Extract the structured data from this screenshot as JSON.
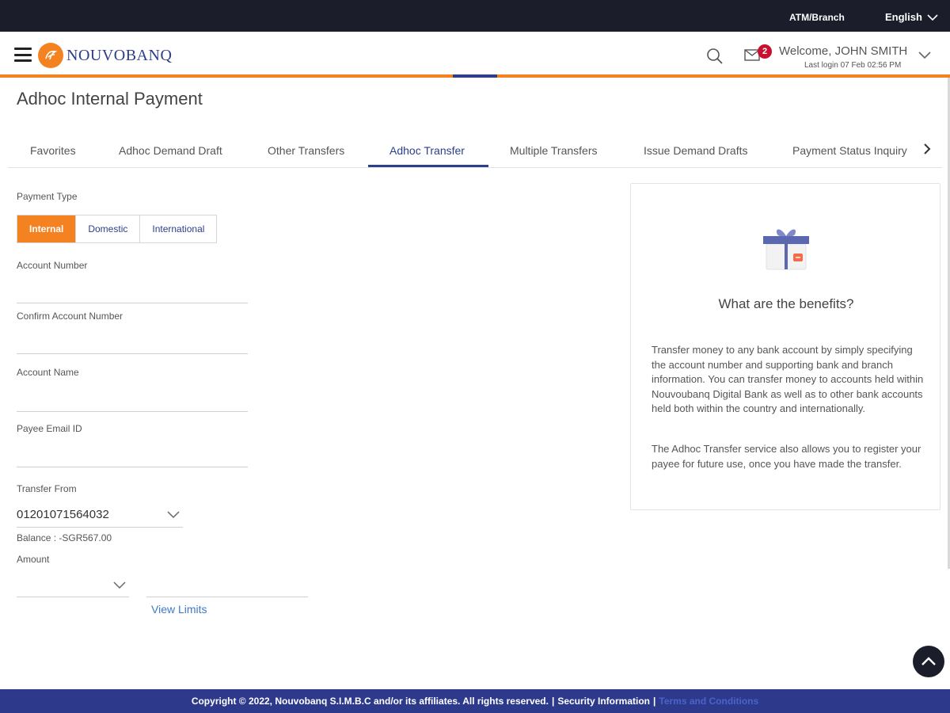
{
  "topbar": {
    "atm_branch": "ATM/Branch",
    "language": "English"
  },
  "header": {
    "logo_text": "NOUVOBANQ",
    "mail_count": "2",
    "welcome": "Welcome, JOHN SMITH",
    "last_login": "Last login 07 Feb 02:56 PM"
  },
  "page": {
    "title": "Adhoc Internal Payment"
  },
  "tabs": [
    {
      "label": "Favorites"
    },
    {
      "label": "Adhoc Demand Draft"
    },
    {
      "label": "Other Transfers"
    },
    {
      "label": "Adhoc Transfer",
      "active": true
    },
    {
      "label": "Multiple Transfers"
    },
    {
      "label": "Issue Demand Drafts"
    },
    {
      "label": "Payment Status Inquiry"
    }
  ],
  "form": {
    "payment_type_label": "Payment Type",
    "payment_types": [
      "Internal",
      "Domestic",
      "International"
    ],
    "selected_payment_type": "Internal",
    "account_number_label": "Account Number",
    "account_number_value": "",
    "confirm_account_number_label": "Confirm Account Number",
    "confirm_account_number_value": "",
    "account_name_label": "Account Name",
    "account_name_value": "",
    "payee_email_label": "Payee Email ID",
    "payee_email_value": "",
    "transfer_from_label": "Transfer From",
    "transfer_from_value": "01201071564032",
    "balance": "Balance : -SGR567.00",
    "amount_label": "Amount",
    "amount_currency_value": "",
    "amount_value": "",
    "view_limits": "View Limits"
  },
  "benefits": {
    "title": "What are the benefits?",
    "paragraph1": "Transfer money to any bank account by simply specifying the account number and supporting bank and branch information. You can transfer money to accounts held within Nouvoubanq Digital Bank as well as to other bank accounts held both within the country and internationally.",
    "paragraph2": "The Adhoc Transfer service also allows you to register your payee for future use, once you have made the transfer."
  },
  "footer": {
    "copyright": "Copyright © 2022, Nouvobanq S.I.M.B.C and/or its affiliates. All rights reserved.",
    "separator": "|",
    "security_info": "Security Information",
    "terms": "Terms and Conditions"
  },
  "colors": {
    "brand_orange": "#f58220",
    "brand_navy": "#2b3f8a",
    "topbar_bg": "#1b1d2b",
    "footer_bg": "#2d3a8c",
    "link_blue": "#3e79c8"
  }
}
